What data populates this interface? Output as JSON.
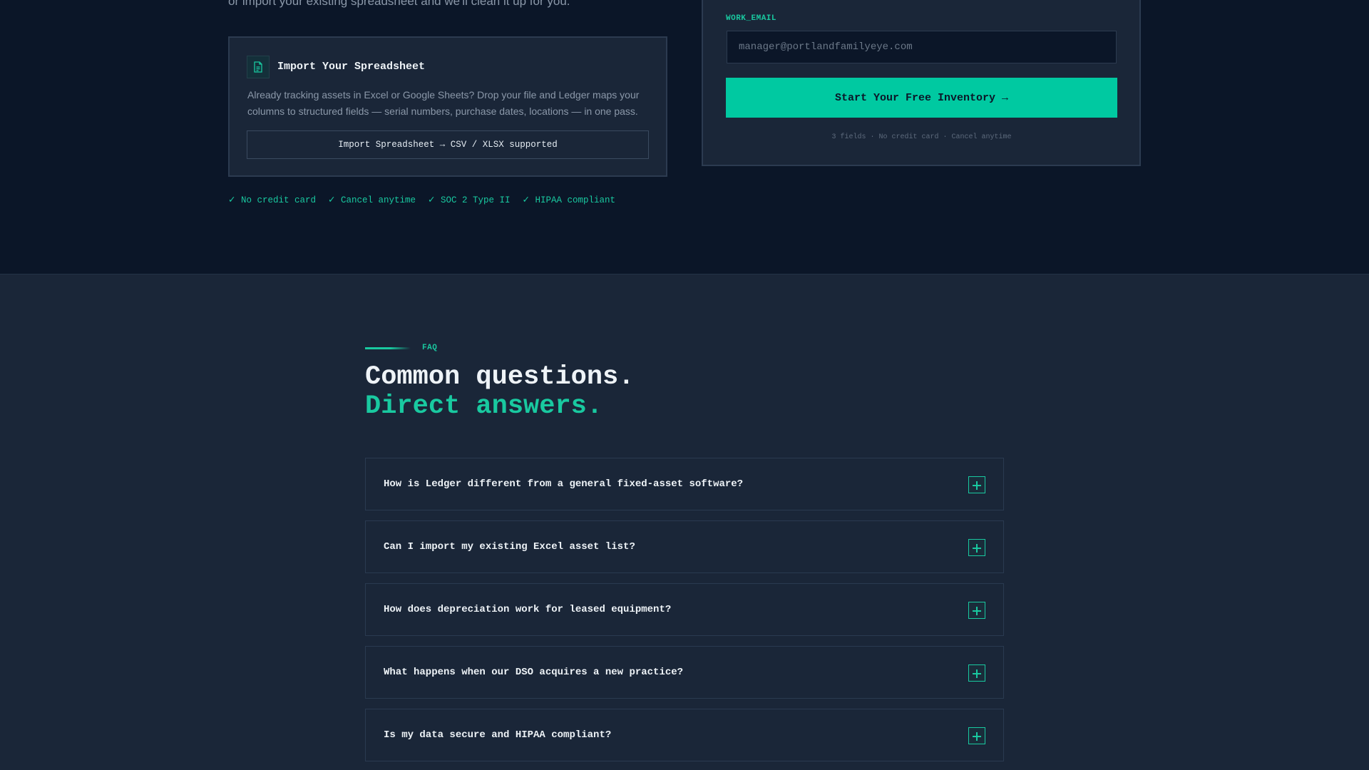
{
  "intro": {
    "text": "or import your existing spreadsheet and we'll clean it up for you."
  },
  "import_card": {
    "icon": "document-icon",
    "title": "Import Your Spreadsheet",
    "description": "Already tracking assets in Excel or Google Sheets? Drop your file and Ledger maps your columns to structured fields — serial numbers, purchase dates, locations — in one pass.",
    "button_label": "Import Spreadsheet → CSV / XLSX supported"
  },
  "trust": [
    "✓ No credit card",
    "✓ Cancel anytime",
    "✓ SOC 2 Type II",
    "✓ HIPAA compliant"
  ],
  "signup_form": {
    "email_label": "WORK_EMAIL",
    "email_placeholder": "manager@portlandfamilyeye.com",
    "submit_label": "Start Your Free Inventory →",
    "note": "3 fields · No credit card · Cancel anytime"
  },
  "faq": {
    "eyebrow": "FAQ",
    "title_line1": "Common questions.",
    "title_line2": "Direct answers.",
    "questions": [
      "How is Ledger different from a general fixed-asset software?",
      "Can I import my existing Excel asset list?",
      "How does depreciation work for leased equipment?",
      "What happens when our DSO acquires a new practice?",
      "Is my data secure and HIPAA compliant?"
    ]
  },
  "colors": {
    "accent": "#19c9a0",
    "button": "#00c9a1",
    "page_bg": "#0b1628",
    "panel_bg": "#1a2638"
  }
}
